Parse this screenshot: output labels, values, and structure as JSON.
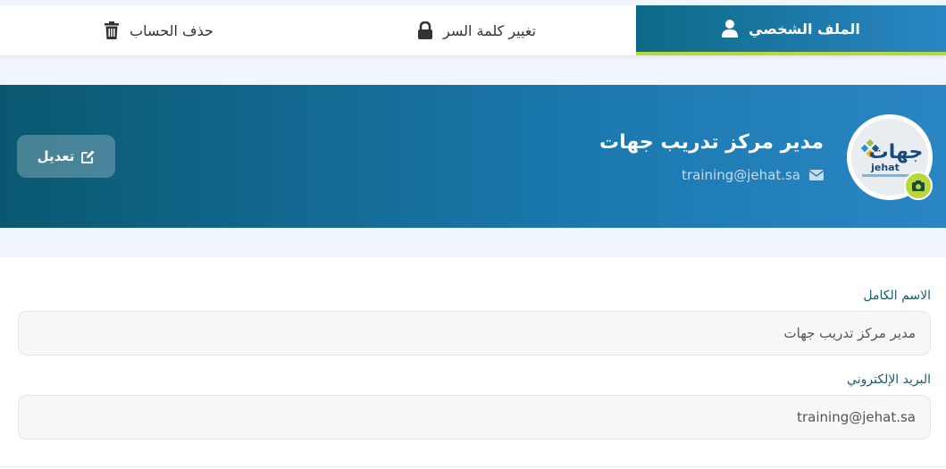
{
  "tabs": {
    "profile_label": "الملف الشخصي",
    "password_label": "تغيير كلمة السر",
    "delete_label": "حذف الحساب"
  },
  "banner": {
    "name": "مدير مركز تدريب جهات",
    "email": "training@jehat.sa",
    "edit_label": "تعديل",
    "logo_arabic": "جهات",
    "logo_latin": "jehat"
  },
  "form": {
    "full_name_label": "الاسم الكامل",
    "full_name_value": "مدير مركز تدريب جهات",
    "email_label": "البريد الإلكتروني",
    "email_value": "training@jehat.sa"
  },
  "colors": {
    "banner_start": "#0a5870",
    "banner_end": "#2a86c4",
    "accent": "#b9d63a"
  },
  "icons": {
    "profile": "user-icon",
    "password": "lock-icon",
    "delete": "trash-icon",
    "email": "envelope-icon",
    "camera": "camera-icon",
    "edit": "edit-icon"
  }
}
